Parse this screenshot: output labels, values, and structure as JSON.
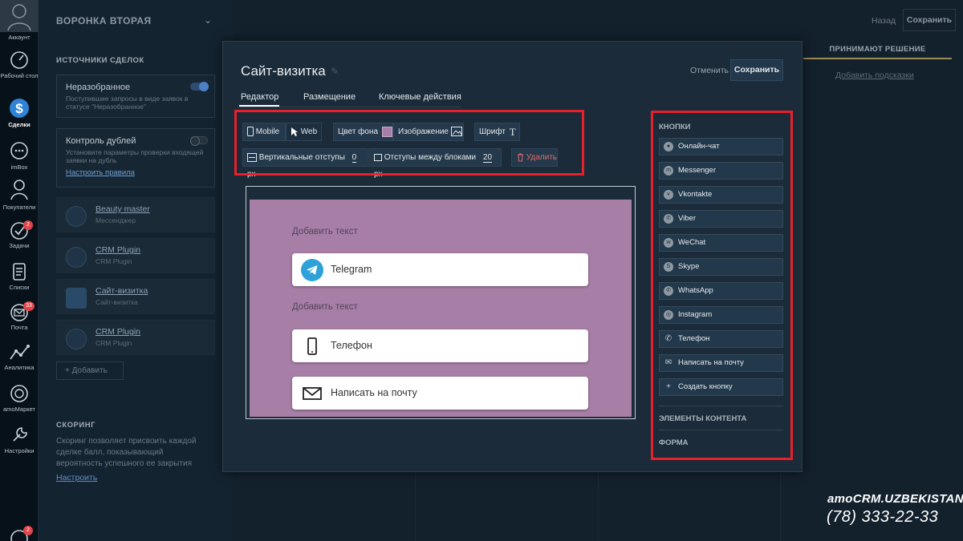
{
  "rail": {
    "items": [
      {
        "label": "Аккаунт",
        "icon": "account-icon"
      },
      {
        "label": "Рабочий стол",
        "icon": "dashboard-icon"
      },
      {
        "label": "Сделки",
        "icon": "deals-icon"
      },
      {
        "label": "imBox",
        "icon": "chat-icon"
      },
      {
        "label": "Покупатели",
        "icon": "customers-icon"
      },
      {
        "label": "Задачи",
        "icon": "tasks-icon",
        "badge": "2"
      },
      {
        "label": "Списки",
        "icon": "lists-icon"
      },
      {
        "label": "Почта",
        "icon": "mail-icon",
        "badge": "33"
      },
      {
        "label": "Аналитика",
        "icon": "analytics-icon"
      },
      {
        "label": "amoМаркет",
        "icon": "market-icon"
      },
      {
        "label": "Настройки",
        "icon": "settings-icon"
      }
    ],
    "bottom_badge": "2"
  },
  "left_panel": {
    "title": "ВОРОНКА ВТОРАЯ",
    "sources_title": "ИСТОЧНИКИ СДЕЛОК",
    "unsorted": {
      "title": "Неразобранное",
      "desc": "Поступившие запросы в виде заявок в статусе \"Неразобранное\""
    },
    "duplicates": {
      "title": "Контроль дублей",
      "desc": "Установите параметры проверки входящей заявки на дубль",
      "link": "Настроить правила"
    },
    "sources": [
      {
        "name": "Beauty master",
        "sub": "Мессенджер"
      },
      {
        "name": "CRM Plugin",
        "sub": "CRM Plugin"
      },
      {
        "name": "Сайт-визитка",
        "sub": "Сайт-визитка"
      },
      {
        "name": "CRM Plugin",
        "sub": "CRM Plugin"
      }
    ],
    "add_label": "+ Добавить",
    "scoring_title": "СКОРИНГ",
    "scoring_desc": "Скоринг позволяет присвоить каждой сделке балл, показывающий вероятность успешного ее закрытия",
    "scoring_link": "Настроить"
  },
  "background": {
    "back_label": "Назад",
    "save_label": "Сохранить",
    "column_title": "ПРИНИМАЮТ РЕШЕНИЕ",
    "hint_link": "Добавить подсказки"
  },
  "modal": {
    "title": "Сайт-визитка",
    "cancel_label": "Отменить",
    "save_label": "Сохранить",
    "tabs": [
      "Редактор",
      "Размещение",
      "Ключевые действия"
    ],
    "toolbar": {
      "mobile": "Mobile",
      "web": "Web",
      "bg_color": "Цвет фона",
      "image": "Изображение",
      "font": "Шрифт",
      "vertical_padding": "Вертикальные отступы",
      "vertical_padding_value": "0",
      "block_spacing": "Отступы между блоками",
      "block_spacing_value": "20",
      "unit": "px",
      "delete": "Удалить"
    },
    "preview": {
      "bg_color": "#a77ea6",
      "text1": "Добавить текст",
      "text2": "Добавить текст",
      "buttons": [
        {
          "label": "Telegram",
          "icon": "telegram-icon"
        },
        {
          "label": "Телефон",
          "icon": "phone-icon"
        },
        {
          "label": "Написать на почту",
          "icon": "envelope-icon"
        }
      ]
    },
    "right_panel": {
      "buttons_title": "КНОПКИ",
      "buttons": [
        {
          "label": "Онлайн-чат",
          "icon": "online-chat-icon"
        },
        {
          "label": "Messenger",
          "icon": "messenger-icon"
        },
        {
          "label": "Vkontakte",
          "icon": "vk-icon"
        },
        {
          "label": "Viber",
          "icon": "viber-icon"
        },
        {
          "label": "WeChat",
          "icon": "wechat-icon"
        },
        {
          "label": "Skype",
          "icon": "skype-icon"
        },
        {
          "label": "WhatsApp",
          "icon": "whatsapp-icon"
        },
        {
          "label": "Instagram",
          "icon": "instagram-icon"
        },
        {
          "label": "Телефон",
          "icon": "phone-icon"
        },
        {
          "label": "Написать на почту",
          "icon": "envelope-icon"
        },
        {
          "label": "Создать кнопку",
          "icon": "plus-icon"
        }
      ],
      "content_title": "ЭЛЕМЕНТЫ КОНТЕНТА",
      "form_title": "ФОРМА"
    }
  },
  "watermark": {
    "brand": "amoCRM.UZBEKISTAN",
    "phone": "(78) 333-22-33"
  },
  "colors": {
    "highlight": "#e8202a",
    "accent": "#4d7fc7",
    "preview_bg": "#a77ea6"
  }
}
